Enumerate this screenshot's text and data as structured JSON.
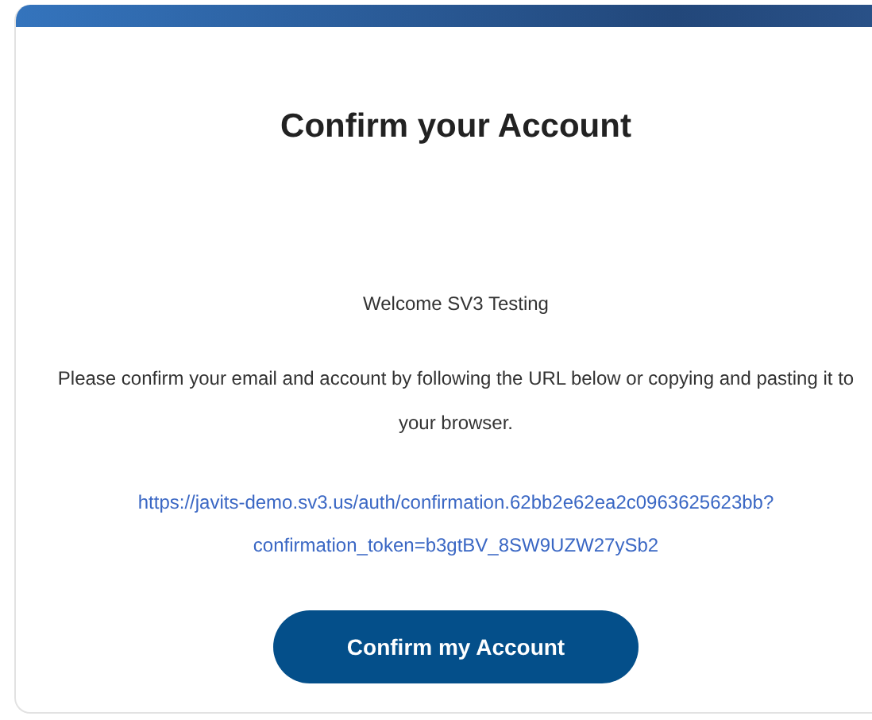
{
  "title": "Confirm your Account",
  "greeting": "Welcome SV3 Testing",
  "message": "Please confirm your email and account by following the URL below or copying and pasting it to your browser.",
  "link": "https://javits-demo.sv3.us/auth/confirmation.62bb2e62ea2c0963625623bb?confirmation_token=b3gtBV_8SW9UZW27ySb2",
  "button": "Confirm my Account"
}
